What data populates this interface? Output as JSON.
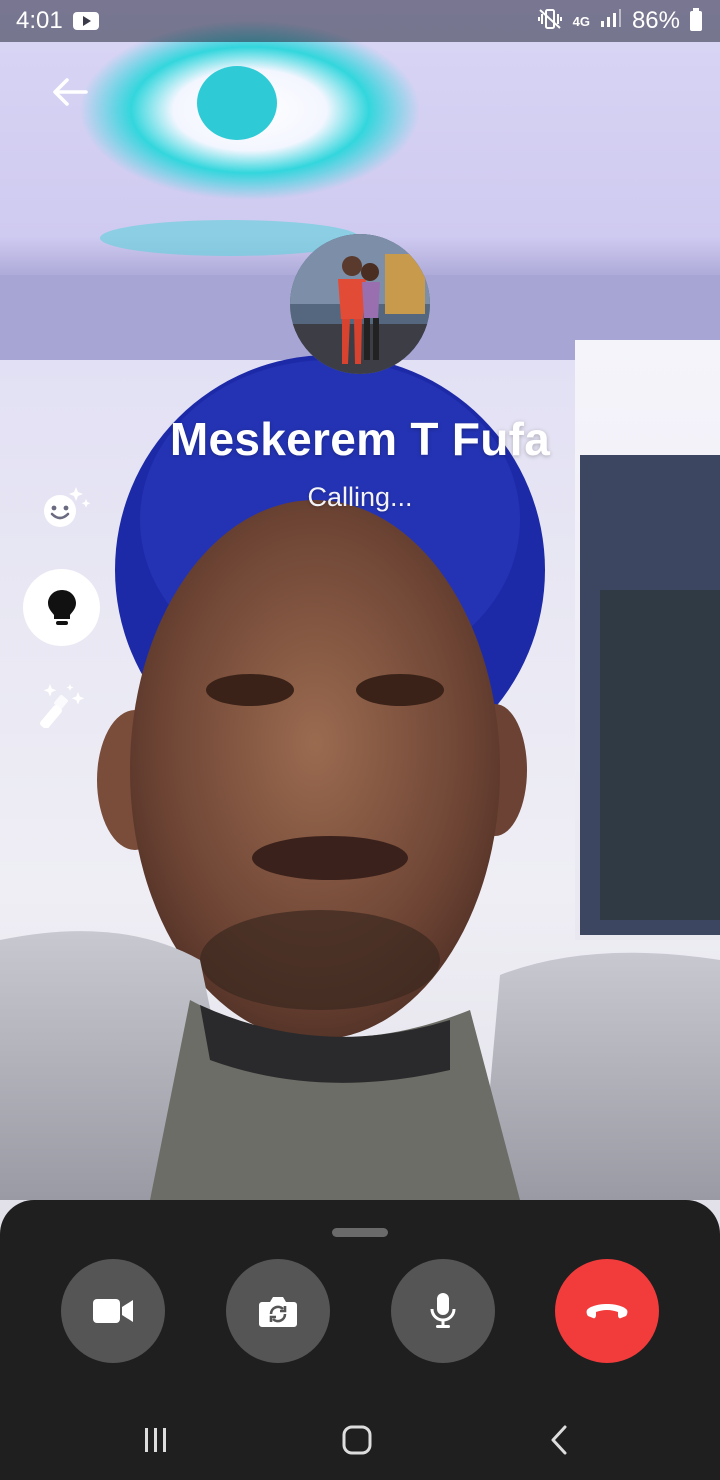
{
  "status_bar": {
    "time": "4:01",
    "network": "4G",
    "battery_percent": "86%",
    "icons": [
      "youtube-notification-icon",
      "vibrate-mute-icon",
      "data-arrows-icon",
      "signal-icon",
      "battery-icon"
    ]
  },
  "header": {
    "back_icon": "arrow-left-icon"
  },
  "caller": {
    "name": "Meskerem T Fufa",
    "status": "Calling..."
  },
  "effects": {
    "items": [
      {
        "name": "effects",
        "icon": "sparkle-smiley-icon"
      },
      {
        "name": "lighting",
        "icon": "lightbulb-icon",
        "active": true
      },
      {
        "name": "filters",
        "icon": "magic-wand-icon"
      }
    ]
  },
  "controls": {
    "items": [
      {
        "name": "camera-toggle",
        "icon": "video-camera-icon"
      },
      {
        "name": "flip-camera",
        "icon": "camera-flip-icon"
      },
      {
        "name": "mute",
        "icon": "microphone-icon"
      },
      {
        "name": "end-call",
        "icon": "phone-hangup-icon"
      }
    ],
    "end_call_color": "#f23b3b",
    "button_color": "#555555",
    "sheet_color": "#1f1f1f"
  },
  "navigation": {
    "items": [
      "recents-icon",
      "home-icon",
      "back-icon"
    ]
  }
}
